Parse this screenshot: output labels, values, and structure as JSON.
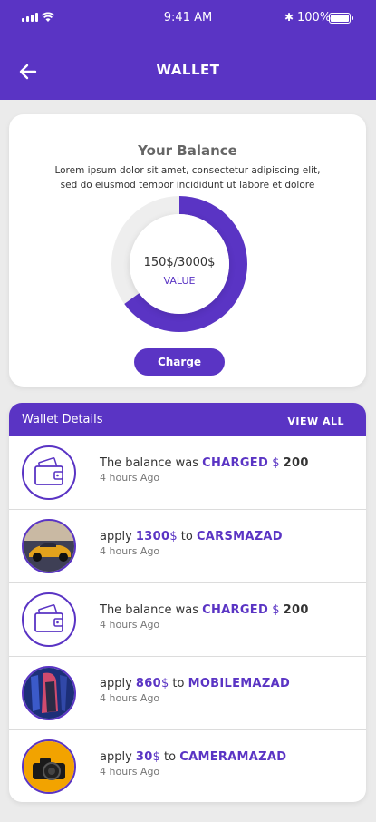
{
  "status_bar": {
    "time": "9:41 AM",
    "battery": "100%"
  },
  "header": {
    "title": "WALLET"
  },
  "balance": {
    "title": "Your Balance",
    "description": "Lorem ipsum dolor sit amet, consectetur adipiscing elit, sed do eiusmod tempor incididunt ut labore et dolore",
    "value_text": "150$/3000$",
    "value_label": "VALUE",
    "progress_fraction": 0.65,
    "charge_label": "Charge"
  },
  "details": {
    "title": "Wallet Details",
    "view_all_label": "VIEW ALL",
    "items": [
      {
        "icon": "wallet-icon",
        "prefix": "The balance was",
        "word": "CHARGED",
        "currency": "$",
        "amount": "200",
        "time": "4 hours Ago"
      },
      {
        "icon": "car-image",
        "prefix": "apply",
        "amount": "1300",
        "currency": "$",
        "to": "to",
        "target": "CARSMAZAD",
        "time": "4 hours Ago"
      },
      {
        "icon": "wallet-icon",
        "prefix": "The balance was",
        "word": "CHARGED",
        "currency": "$",
        "amount": "200",
        "time": "4 hours Ago"
      },
      {
        "icon": "mobile-image",
        "prefix": "apply",
        "amount": "860",
        "currency": "$",
        "to": "to",
        "target": "MOBILEMAZAD",
        "time": "4 hours Ago"
      },
      {
        "icon": "camera-image",
        "prefix": "apply",
        "amount": "30",
        "currency": "$",
        "to": "to",
        "target": "CAMERAMAZAD",
        "time": "4 hours Ago"
      }
    ]
  },
  "colors": {
    "primary": "#5a34c4",
    "background": "#ebebeb"
  }
}
